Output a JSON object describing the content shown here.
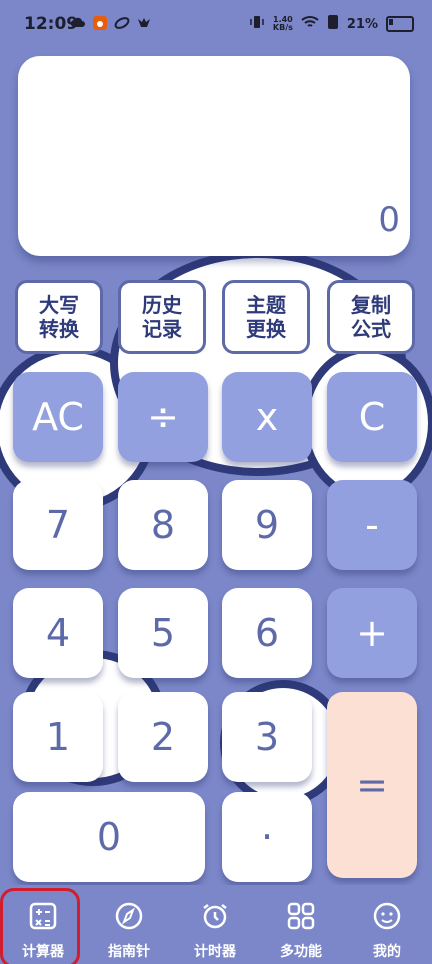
{
  "status_bar": {
    "time": "12:09",
    "net_rate_top": "1.40",
    "net_rate_bottom": "KB/s",
    "battery": "21%"
  },
  "display": {
    "value": "0"
  },
  "function_buttons": [
    {
      "line1": "大写",
      "line2": "转换"
    },
    {
      "line1": "历史",
      "line2": "记录"
    },
    {
      "line1": "主题",
      "line2": "更换"
    },
    {
      "line1": "复制",
      "line2": "公式"
    }
  ],
  "keys": {
    "ac": "AC",
    "divide": "÷",
    "multiply": "x",
    "clear": "C",
    "seven": "7",
    "eight": "8",
    "nine": "9",
    "minus": "-",
    "four": "4",
    "five": "5",
    "six": "6",
    "plus": "+",
    "one": "1",
    "two": "2",
    "three": "3",
    "equals": "=",
    "zero": "0",
    "dot": "·"
  },
  "bottom_nav": [
    {
      "label": "计算器",
      "icon": "calculator-icon"
    },
    {
      "label": "指南针",
      "icon": "compass-icon"
    },
    {
      "label": "计时器",
      "icon": "alarm-clock-icon"
    },
    {
      "label": "多功能",
      "icon": "grid-icon"
    },
    {
      "label": "我的",
      "icon": "smiley-icon"
    }
  ],
  "colors": {
    "background": "#7b87c8",
    "key_blue": "#93a0e0",
    "key_peach": "#fde0d4",
    "text_primary": "#5e6aa8",
    "active_highlight": "#d01e2e"
  }
}
